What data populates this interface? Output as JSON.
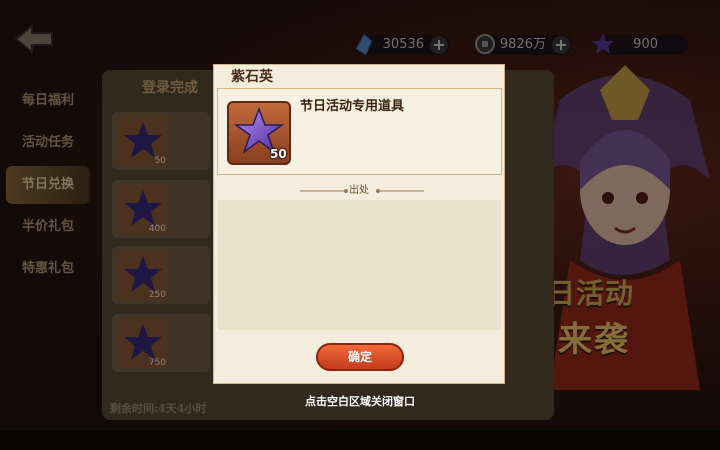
{
  "colors": {
    "accent": "#c43a1e",
    "modal_bg": "#f4eddd",
    "gold": "#d8ad57"
  },
  "resources": [
    {
      "icon": "crystal-icon",
      "value": "30536"
    },
    {
      "icon": "coin-icon",
      "value": "9826万"
    },
    {
      "icon": "purple-star-icon",
      "value": "900"
    }
  ],
  "sidebar": {
    "items": [
      {
        "label": "每日福利"
      },
      {
        "label": "活动任务"
      },
      {
        "label": "节日兑换",
        "active": true
      },
      {
        "label": "半价礼包"
      },
      {
        "label": "特惠礼包"
      }
    ]
  },
  "panel": {
    "header": "登录完成",
    "rows": [
      {
        "count": "50"
      },
      {
        "count": "400"
      },
      {
        "count": "250"
      },
      {
        "count": "750"
      }
    ],
    "remaining": "剩余时间:4天4小时"
  },
  "banner": {
    "line1": "节日活动",
    "line2": "福利来袭"
  },
  "modal": {
    "title": "紫石英",
    "item_desc": "节日活动专用道具",
    "item_count": "50",
    "source_label": "出处",
    "confirm_label": "确定",
    "close_hint": "点击空白区域关闭窗口"
  }
}
